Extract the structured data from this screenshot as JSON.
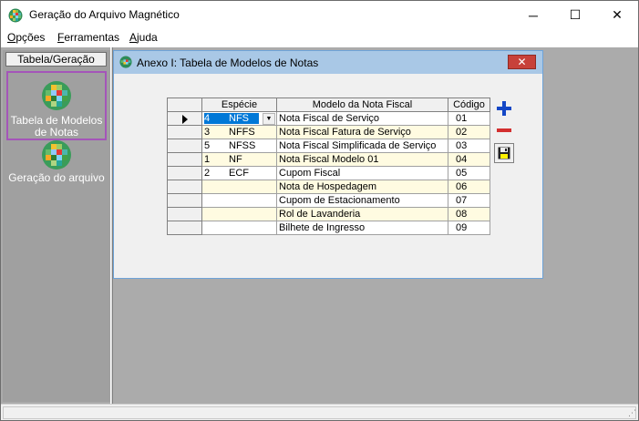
{
  "window": {
    "title": "Geração do Arquivo Magnético",
    "minimize_glyph": "─",
    "maximize_glyph": "☐",
    "close_glyph": "✕"
  },
  "menu": {
    "items": [
      {
        "label": "Opções"
      },
      {
        "label": "Ferramentas"
      },
      {
        "label": "Ajuda"
      }
    ]
  },
  "left_panel": {
    "header": "Tabela/Geração",
    "items": [
      {
        "label": "Tabela de Modelos de Notas",
        "icon": "mosaic-icon",
        "selected": true
      },
      {
        "label": "Geração do arquivo",
        "icon": "mosaic-icon",
        "selected": false
      }
    ]
  },
  "child_window": {
    "title": "Anexo I: Tabela de Modelos de Notas",
    "close_glyph": "✕",
    "grid": {
      "columns": [
        "Espécie",
        "Modelo da Nota Fiscal",
        "Código"
      ],
      "rows": [
        {
          "code": "4",
          "especie": "NFS",
          "modelo": "Nota Fiscal de Serviço",
          "codigo": "01"
        },
        {
          "code": "3",
          "especie": "NFFS",
          "modelo": "Nota Fiscal Fatura de Serviço",
          "codigo": "02"
        },
        {
          "code": "5",
          "especie": "NFSS",
          "modelo": "Nota Fiscal Simplificada de Serviço",
          "codigo": "03"
        },
        {
          "code": "1",
          "especie": "NF",
          "modelo": "Nota Fiscal Modelo 01",
          "codigo": "04"
        },
        {
          "code": "2",
          "especie": "ECF",
          "modelo": "Cupom Fiscal",
          "codigo": "05"
        },
        {
          "code": "",
          "especie": "",
          "modelo": "Nota de Hospedagem",
          "codigo": "06"
        },
        {
          "code": "",
          "especie": "",
          "modelo": "Cupom de Estacionamento",
          "codigo": "07"
        },
        {
          "code": "",
          "especie": "",
          "modelo": "Rol de Lavanderia",
          "codigo": "08"
        },
        {
          "code": "",
          "especie": "",
          "modelo": "Bilhete de Ingresso",
          "codigo": "09"
        }
      ]
    },
    "buttons": {
      "add_icon": "plus-icon",
      "remove_icon": "minus-icon",
      "save_icon": "floppy-icon"
    }
  },
  "colors": {
    "accent_blue": "#0078d7",
    "child_title_bg": "#a9c8e6",
    "selected_border": "#a455b9",
    "odd_row": "#ffffff",
    "even_row": "#fffbe1",
    "close_red": "#c7413a"
  }
}
